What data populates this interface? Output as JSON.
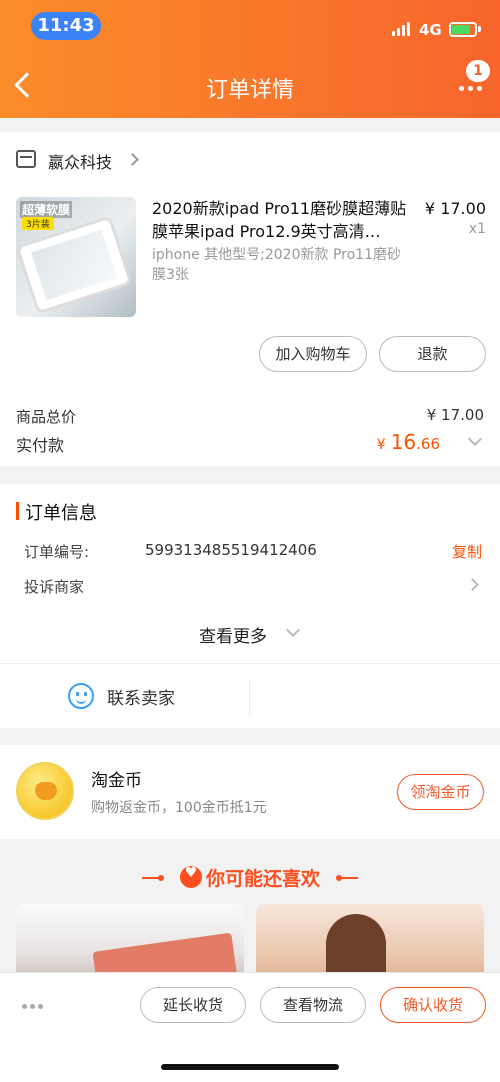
{
  "status_bar": {
    "time": "11:43",
    "network": "4G"
  },
  "header": {
    "title": "订单详情",
    "badge_count": "1"
  },
  "shop": {
    "name": "嬴众科技"
  },
  "product": {
    "title": "2020新款ipad Pro11磨砂膜超薄贴膜苹果ipad Pro12.9英寸高清…",
    "price": "¥ 17.00",
    "quantity": "x1",
    "spec": "iphone 其他型号;2020新款 Pro11磨砂膜3张",
    "image_tag": "超薄软膜",
    "image_tag_sub": "3片装",
    "add_to_cart_label": "加入购物车",
    "refund_label": "退款"
  },
  "totals": {
    "goods_total_label": "商品总价",
    "goods_total_value": "¥ 17.00",
    "paid_label": "实付款",
    "paid_currency": "¥",
    "paid_integer": "16",
    "paid_decimal": ".66"
  },
  "order_info": {
    "title": "订单信息",
    "order_no_label": "订单编号:",
    "order_no_value": "599313485519412406",
    "copy_label": "复制",
    "complain_label": "投诉商家",
    "see_more_label": "查看更多",
    "contact_seller_label": "联系卖家"
  },
  "coins": {
    "title": "淘金币",
    "desc": "购物返金币，100金币抵1元",
    "button_label": "领淘金币"
  },
  "recommend": {
    "title": "你可能还喜欢"
  },
  "bottom_bar": {
    "extend_label": "延长收货",
    "logistics_label": "查看物流",
    "confirm_label": "确认收货"
  },
  "colors": {
    "accent": "#ff5000",
    "header_start": "#fb8c2a",
    "header_end": "#f7652c",
    "link_blue": "#3aa0f5"
  },
  "icons": [
    "back-icon",
    "more-icon",
    "shop-icon",
    "chevron-right-icon",
    "chevron-down-icon",
    "contact-icon",
    "coin-icon",
    "heart-icon",
    "dots-icon"
  ]
}
